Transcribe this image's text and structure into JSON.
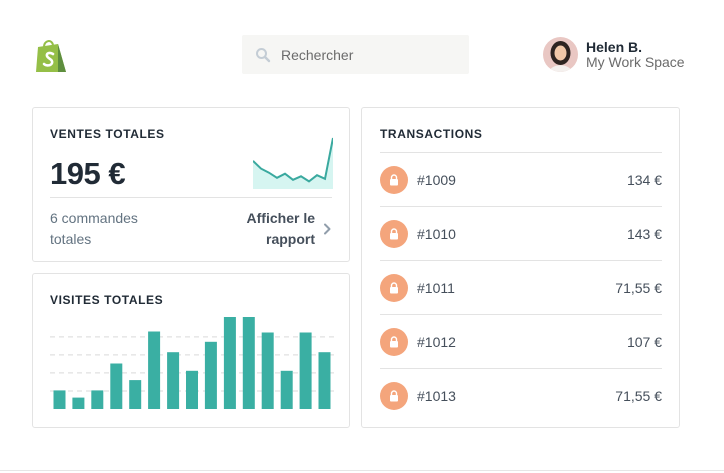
{
  "header": {
    "logo_icon": "shopify-bag-icon",
    "search": {
      "placeholder": "Rechercher",
      "value": "",
      "icon": "search-icon"
    },
    "user": {
      "name": "Helen B.",
      "workspace": "My Work Space",
      "avatar": "user-avatar"
    }
  },
  "sales_card": {
    "title": "VENTES TOTALES",
    "amount": "195 €",
    "orders_text": "6 commandes totales",
    "report_link": "Afficher le rapport",
    "chevron_icon": "chevron-right-icon",
    "sparkline": [
      0.55,
      0.4,
      0.32,
      0.22,
      0.3,
      0.18,
      0.25,
      0.15,
      0.27,
      0.2,
      1.0
    ],
    "accent_color": "#3aa99f",
    "fill_color": "#d6f5f1"
  },
  "visits_card": {
    "title": "VISITES TOTALES",
    "chart_data": {
      "type": "bar",
      "values": [
        18,
        11,
        18,
        44,
        28,
        75,
        55,
        37,
        65,
        89,
        89,
        74,
        37,
        74,
        55
      ],
      "ylim": [
        0,
        90
      ],
      "grid": true,
      "bar_color": "#3aafa3"
    }
  },
  "transactions": {
    "title": "TRANSACTIONS",
    "lock_color": "#f4a57c",
    "items": [
      {
        "id": "#1009",
        "amount": "134 €"
      },
      {
        "id": "#1010",
        "amount": "143 €"
      },
      {
        "id": "#1011",
        "amount": "71,55 €"
      },
      {
        "id": "#1012",
        "amount": "107 €"
      },
      {
        "id": "#1013",
        "amount": "71,55 €"
      }
    ]
  }
}
